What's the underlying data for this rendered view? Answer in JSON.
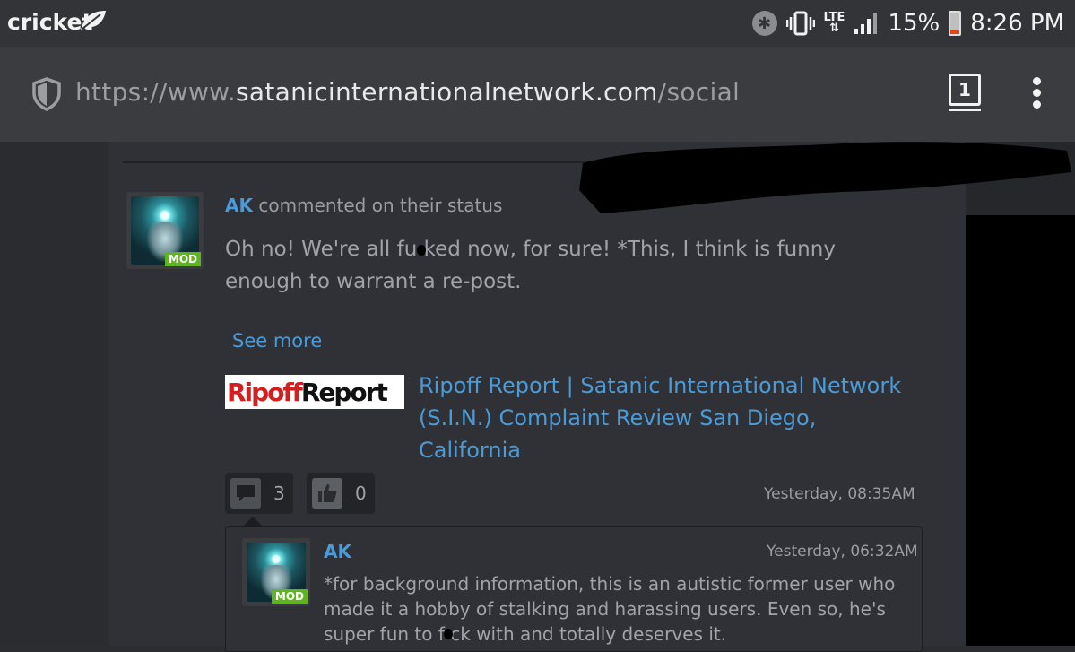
{
  "status_bar": {
    "carrier": "cricket",
    "battery_percent": "15%",
    "battery_level": 0.15,
    "time": "8:26 PM",
    "network": "LTE"
  },
  "browser": {
    "url_prefix": "https://www.",
    "url_domain": "satanicinternationalnetwork.com",
    "url_path": "/social",
    "tab_count": "1"
  },
  "post": {
    "author": "AK",
    "action": "commented on their status",
    "badge": "MOD",
    "text": "Oh no! We're all fu  ked now, for sure! *This, I think is funny enough to warrant a re-post.",
    "see_more": "See more",
    "link_logo_left": "Ripoff",
    "link_logo_right": "Report",
    "link_title": "Ripoff Report | Satanic International Network (S.I.N.) Complaint Review San Diego, California",
    "comment_count": "3",
    "like_count": "0",
    "timestamp": "Yesterday, 08:35AM"
  },
  "reply": {
    "author": "AK",
    "badge": "MOD",
    "timestamp": "Yesterday, 06:32AM",
    "text": "*for background information, this is an autistic former user who made it a hobby of stalking and harassing users. Even so, he's super fun to f  ck with and totally deserves it."
  },
  "colors": {
    "link": "#4c9bd6",
    "mod_badge": "#5eb51f",
    "battery_low": "#e0461c"
  }
}
